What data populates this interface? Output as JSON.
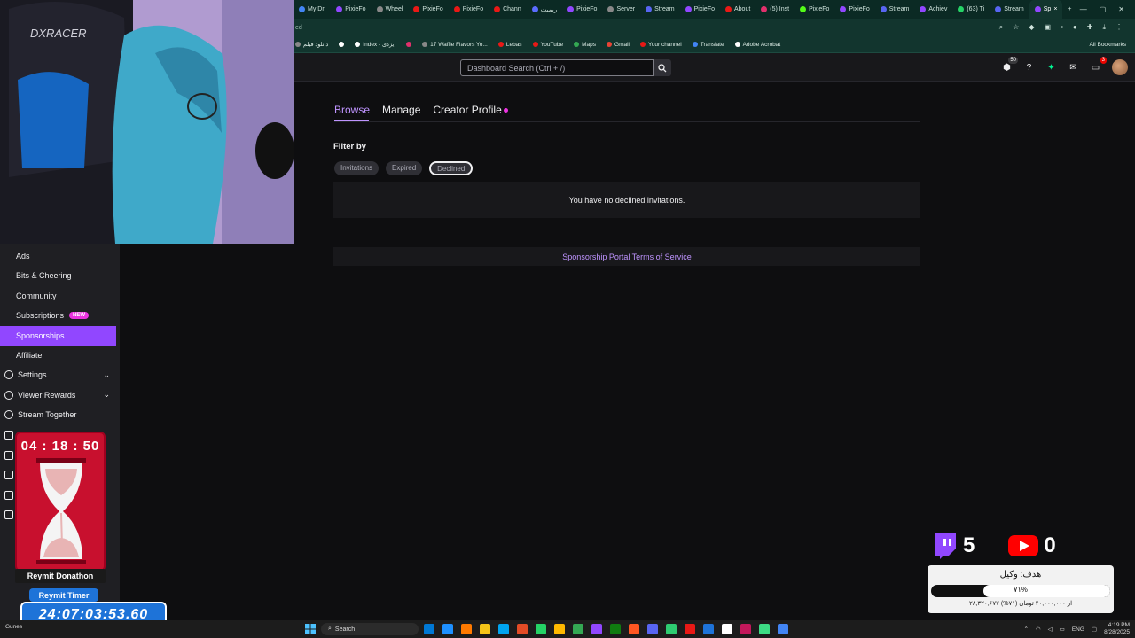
{
  "browser": {
    "tabs": [
      {
        "label": "My Dri",
        "color": "#4285f4"
      },
      {
        "label": "PixieFo",
        "color": "#9147ff"
      },
      {
        "label": "Wheel",
        "color": "#888888"
      },
      {
        "label": "PixieFo",
        "color": "#e91916"
      },
      {
        "label": "PixieFo",
        "color": "#e91916"
      },
      {
        "label": "Chann",
        "color": "#e91916"
      },
      {
        "label": "ریمیت",
        "color": "#5b6cff"
      },
      {
        "label": "PixieFo",
        "color": "#9147ff"
      },
      {
        "label": "Server",
        "color": "#888888"
      },
      {
        "label": "Stream",
        "color": "#5865f2"
      },
      {
        "label": "PixieFo",
        "color": "#9147ff"
      },
      {
        "label": "About",
        "color": "#e91916"
      },
      {
        "label": "(5) Inst",
        "color": "#e1306c"
      },
      {
        "label": "PixieFo",
        "color": "#53fc18"
      },
      {
        "label": "PixieFo",
        "color": "#9147ff"
      },
      {
        "label": "Stream",
        "color": "#5865f2"
      },
      {
        "label": "Achiev",
        "color": "#9147ff"
      },
      {
        "label": "(63) Ti",
        "color": "#25d366"
      },
      {
        "label": "Stream",
        "color": "#5865f2"
      },
      {
        "label": "Sp",
        "color": "#9147ff",
        "active": true
      }
    ],
    "window_controls": [
      "—",
      "▢",
      "✕"
    ],
    "address_partial": "ed",
    "bookmarks": [
      {
        "label": "دانلود فیلم",
        "color": "#888888"
      },
      {
        "label": "",
        "color": "#ffffff"
      },
      {
        "label": "Index - ایزدی",
        "color": "#ffffff"
      },
      {
        "label": "",
        "color": "#e1306c"
      },
      {
        "label": "17 Waffle Flavors Yo...",
        "color": "#888888"
      },
      {
        "label": "Lebas",
        "color": "#e91916"
      },
      {
        "label": "YouTube",
        "color": "#e91916"
      },
      {
        "label": "Maps",
        "color": "#34a853"
      },
      {
        "label": "Gmail",
        "color": "#ea4335"
      },
      {
        "label": "Your channel",
        "color": "#e91916"
      },
      {
        "label": "Translate",
        "color": "#4285f4"
      },
      {
        "label": "Adobe Acrobat",
        "color": "#ffffff"
      }
    ],
    "all_bookmarks": "All Bookmarks"
  },
  "topnav": {
    "search_placeholder": "Dashboard Search (Ctrl + /)",
    "notif_counts": {
      "bits": "50",
      "inbox": "3"
    }
  },
  "content": {
    "tabs": [
      {
        "label": "Browse",
        "active": true
      },
      {
        "label": "Manage"
      },
      {
        "label": "Creator Profile",
        "dot": true
      }
    ],
    "filter_label": "Filter by",
    "filters": [
      {
        "label": "Invitations"
      },
      {
        "label": "Expired"
      },
      {
        "label": "Declined",
        "selected": true
      }
    ],
    "empty_message": "You have no declined invitations.",
    "tos_link": "Sponsorship Portal Terms of Service"
  },
  "sidebar": {
    "items": [
      {
        "label": "Ads"
      },
      {
        "label": "Bits & Cheering"
      },
      {
        "label": "Community"
      },
      {
        "label": "Subscriptions",
        "badge": "NEW"
      },
      {
        "label": "Sponsorships",
        "active": true
      },
      {
        "label": "Affiliate"
      },
      {
        "label": "Settings",
        "icon": "gear-icon",
        "chevron": true
      },
      {
        "label": "Viewer Rewards",
        "icon": "reward-icon",
        "chevron": true
      },
      {
        "label": "Stream Together",
        "icon": "people-icon"
      }
    ]
  },
  "overlay": {
    "webcam_brand": "DXRACER",
    "countdown": "04 : 18 : 50",
    "donathon_label": "Reymit Donathon",
    "reymit_label": "Reymit Timer",
    "reymit_time": "24:07:03:53.60",
    "twitch_count": "5",
    "youtube_count": "0",
    "goal_title": "هدف: وکیل",
    "goal_percent_text": "۷۱%",
    "goal_fraction": 0.71,
    "goal_sub": "۲۸,۳۲۰,۶۷۷ از ۴۰,۰۰۰,۰۰۰ تومان (۷۱%)"
  },
  "taskbar": {
    "search_label": "Search",
    "lang": "ENG",
    "time": "4:19 PM",
    "date": "8/28/2025",
    "weather": "Gunes",
    "app_colors": [
      "#0078d4",
      "#1e90ff",
      "#ff7a00",
      "#f5c518",
      "#00a4ef",
      "#e34c26",
      "#25d366",
      "#ffb900",
      "#34a853",
      "#9147ff",
      "#107c10",
      "#ff5722",
      "#5865f2",
      "#2ecc71",
      "#e91916",
      "#1e73d8",
      "#ffffff",
      "#c2185b",
      "#3ddc84",
      "#4285f4"
    ]
  }
}
